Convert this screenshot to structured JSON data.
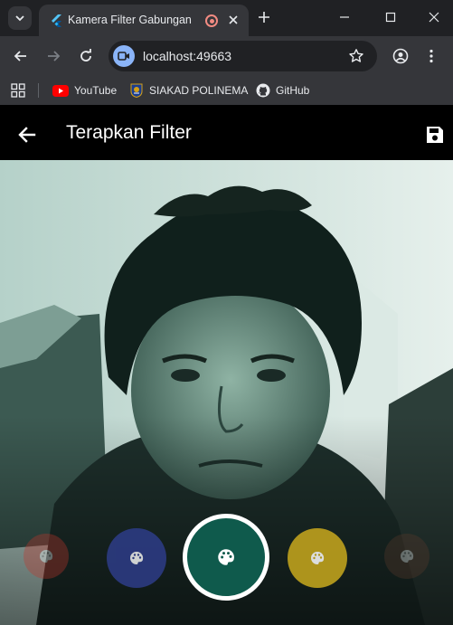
{
  "browser": {
    "tab_title": "Kamera Filter Gabungan",
    "url": "localhost:49663",
    "bookmarks": [
      {
        "label": "YouTube",
        "icon": "youtube-icon"
      },
      {
        "label": "SIAKAD POLINEMA",
        "icon": "polinema-logo-icon"
      },
      {
        "label": "GitHub",
        "icon": "github-icon"
      }
    ]
  },
  "app": {
    "title": "Terapkan Filter",
    "back_icon": "arrow-back-icon",
    "save_icon": "save-icon"
  },
  "filters": [
    {
      "name": "red",
      "color": "#c0362c",
      "selected": false,
      "icon": "palette-icon"
    },
    {
      "name": "blue",
      "color": "#2f3e8f",
      "selected": false,
      "icon": "palette-icon"
    },
    {
      "name": "teal",
      "color": "#0f5a4c",
      "selected": true,
      "icon": "palette-icon"
    },
    {
      "name": "yellow",
      "color": "#c9a91d",
      "selected": false,
      "icon": "palette-icon"
    },
    {
      "name": "brown",
      "color": "#5a3a2c",
      "selected": false,
      "icon": "palette-icon"
    }
  ],
  "colors": {
    "camera_tint": "#9cc3b6",
    "accent": "#8ab4f8"
  }
}
